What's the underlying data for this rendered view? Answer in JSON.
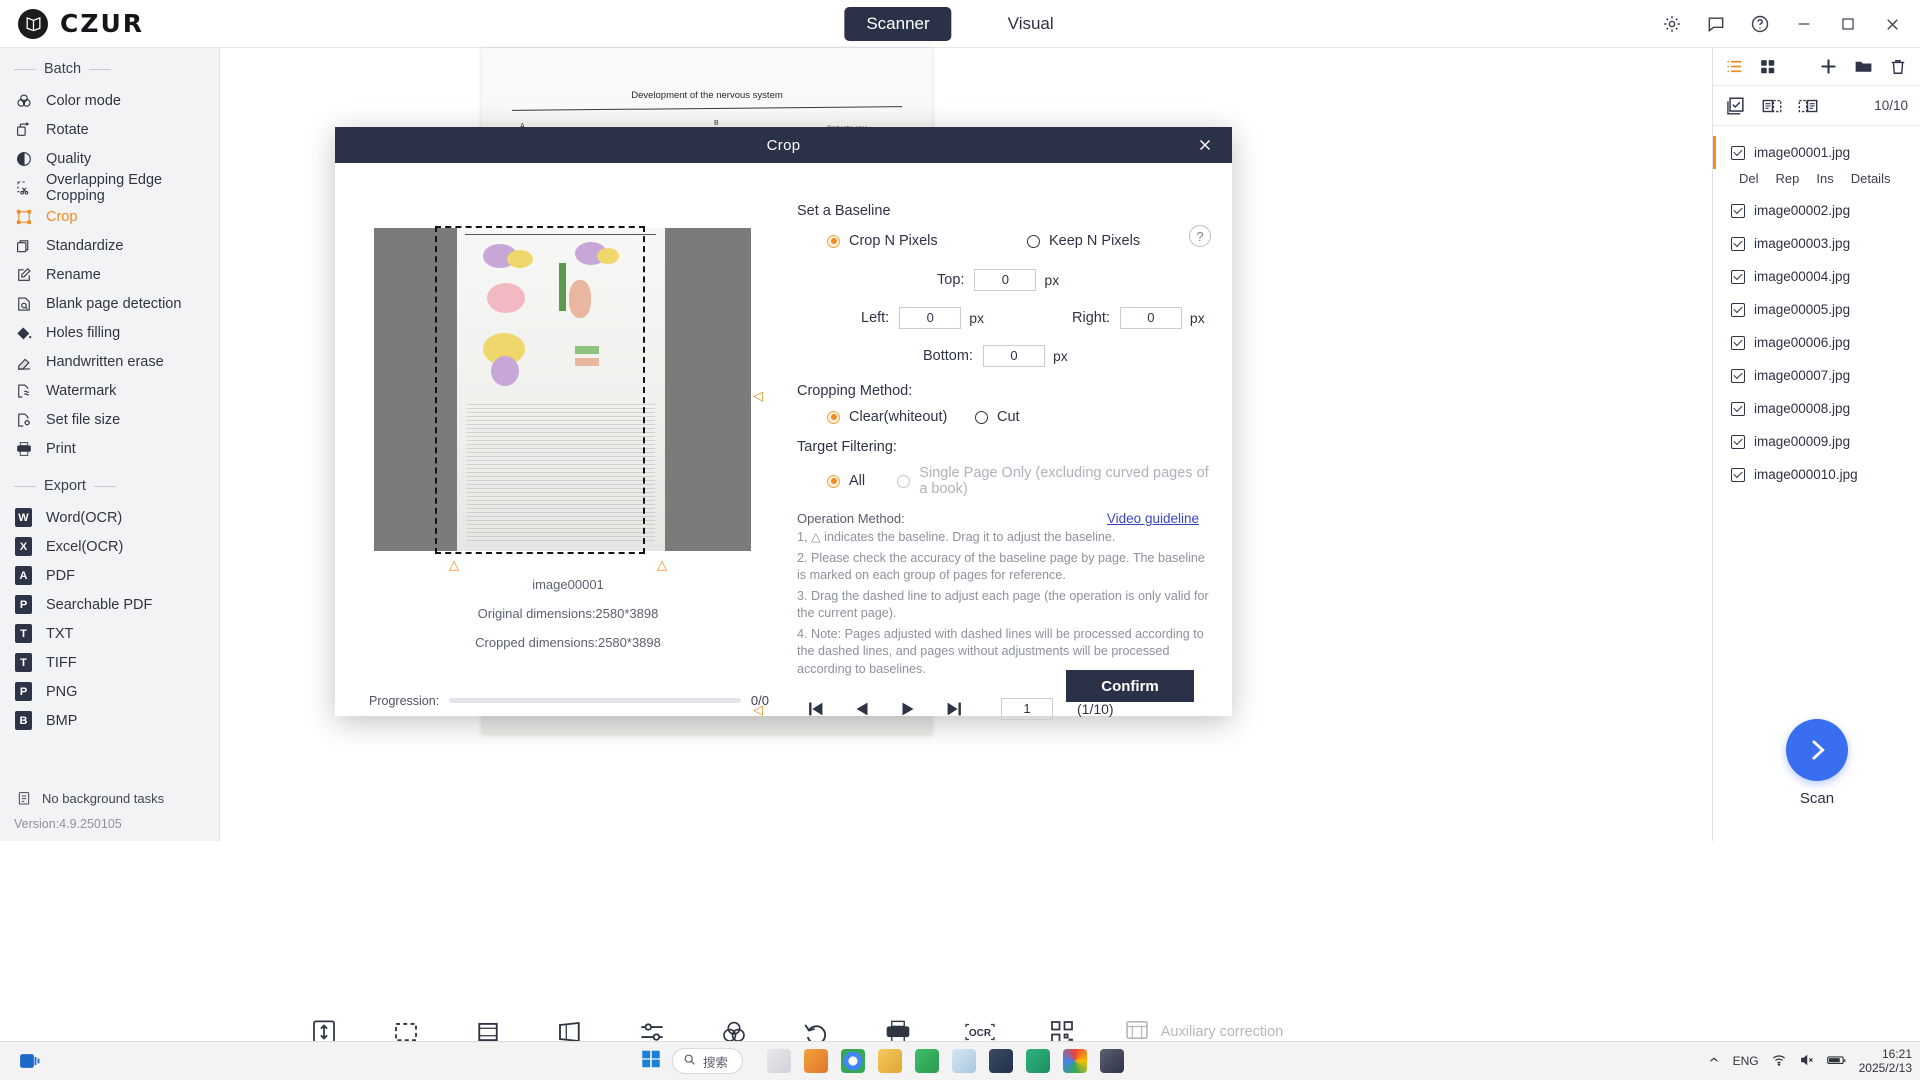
{
  "app": {
    "brand": "CZUR",
    "logo_icon": "book-logo-icon"
  },
  "topnav": {
    "tabs": [
      {
        "label": "Scanner",
        "active": true
      },
      {
        "label": "Visual",
        "active": false
      }
    ]
  },
  "window_controls": {
    "settings_icon": "gear-icon",
    "feedback_icon": "message-icon",
    "help_icon": "question-circle-icon",
    "minimize_icon": "minimize-icon",
    "maximize_icon": "maximize-icon",
    "close_icon": "close-icon"
  },
  "sidebar": {
    "group_batch": "Batch",
    "group_export": "Export",
    "batch_items": [
      {
        "label": "Color mode",
        "icon": "color-circles-icon",
        "active": false
      },
      {
        "label": "Rotate",
        "icon": "rotate-pages-icon",
        "active": false
      },
      {
        "label": "Quality",
        "icon": "contrast-icon",
        "active": false
      },
      {
        "label": "Overlapping Edge Cropping",
        "icon": "scissors-crop-icon",
        "active": false
      },
      {
        "label": "Crop",
        "icon": "crop-handles-icon",
        "active": true
      },
      {
        "label": "Standardize",
        "icon": "stack-pages-icon",
        "active": false
      },
      {
        "label": "Rename",
        "icon": "pencil-square-icon",
        "active": false
      },
      {
        "label": "Blank page detection",
        "icon": "page-search-icon",
        "active": false
      },
      {
        "label": "Holes filling",
        "icon": "paint-bucket-icon",
        "active": false
      },
      {
        "label": "Handwritten erase",
        "icon": "eraser-icon",
        "active": false
      },
      {
        "label": "Watermark",
        "icon": "watermark-page-icon",
        "active": false
      },
      {
        "label": "Set file size",
        "icon": "file-size-icon",
        "active": false
      },
      {
        "label": "Print",
        "icon": "printer-icon",
        "active": false
      }
    ],
    "export_items": [
      {
        "label": "Word(OCR)",
        "badge": "W"
      },
      {
        "label": "Excel(OCR)",
        "badge": "X"
      },
      {
        "label": "PDF",
        "badge": "A"
      },
      {
        "label": "Searchable PDF",
        "badge": "P"
      },
      {
        "label": "TXT",
        "badge": "T"
      },
      {
        "label": "TIFF",
        "badge": "T"
      },
      {
        "label": "PNG",
        "badge": "P"
      },
      {
        "label": "BMP",
        "badge": "B"
      }
    ],
    "footer": {
      "task_status": "No background tasks",
      "task_icon": "clipboard-icon",
      "version": "Version:4.9.250105"
    }
  },
  "canvas": {
    "document_title": "Development of the nervous system",
    "labels": [
      "A",
      "B"
    ],
    "caption_right": "Orchestra spec"
  },
  "toolbar": {
    "buttons": [
      {
        "icon": "fit-height-icon",
        "name": "fit-height-button"
      },
      {
        "icon": "marquee-select-icon",
        "name": "marquee-select-button"
      },
      {
        "icon": "crop-frame-icon",
        "name": "crop-button"
      },
      {
        "icon": "perspective-correct-icon",
        "name": "perspective-button"
      },
      {
        "icon": "sliders-icon",
        "name": "adjust-button"
      },
      {
        "icon": "color-circles-icon",
        "name": "color-button"
      },
      {
        "icon": "undo-icon",
        "name": "undo-button"
      },
      {
        "icon": "printer-icon",
        "name": "print-button"
      },
      {
        "icon": "ocr-icon",
        "name": "ocr-button"
      },
      {
        "icon": "qr-code-icon",
        "name": "qrcode-button"
      }
    ],
    "auxiliary_label": "Auxiliary correction",
    "auxiliary_icon": "auxiliary-correction-icon"
  },
  "right_panel": {
    "view_list_icon": "list-view-icon",
    "view_grid_icon": "grid-view-icon",
    "add_icon": "plus-icon",
    "folder_icon": "folder-icon",
    "delete_icon": "trash-icon",
    "select_all_icon": "select-all-icon",
    "select_odd_icon": "select-odd-icon",
    "select_even_icon": "select-even-icon",
    "count": "10/10",
    "selected_actions": [
      "Del",
      "Rep",
      "Ins",
      "Details"
    ],
    "files": [
      {
        "name": "image00001.jpg",
        "checked": true,
        "selected": true
      },
      {
        "name": "image00002.jpg",
        "checked": true,
        "selected": false
      },
      {
        "name": "image00003.jpg",
        "checked": true,
        "selected": false
      },
      {
        "name": "image00004.jpg",
        "checked": true,
        "selected": false
      },
      {
        "name": "image00005.jpg",
        "checked": true,
        "selected": false
      },
      {
        "name": "image00006.jpg",
        "checked": true,
        "selected": false
      },
      {
        "name": "image00007.jpg",
        "checked": true,
        "selected": false
      },
      {
        "name": "image00008.jpg",
        "checked": true,
        "selected": false
      },
      {
        "name": "image00009.jpg",
        "checked": true,
        "selected": false
      },
      {
        "name": "image000010.jpg",
        "checked": true,
        "selected": false
      }
    ],
    "scan_label": "Scan",
    "scan_icon": "chevron-right-icon"
  },
  "dialog": {
    "title": "Crop",
    "close_icon": "close-icon",
    "help_icon": "question-icon",
    "baseline_section": "Set a Baseline",
    "baseline_options": [
      {
        "label": "Crop N Pixels",
        "selected": true
      },
      {
        "label": "Keep N Pixels",
        "selected": false
      }
    ],
    "fields": {
      "top_label": "Top:",
      "top_value": "0",
      "left_label": "Left:",
      "left_value": "0",
      "right_label": "Right:",
      "right_value": "0",
      "bottom_label": "Bottom:",
      "bottom_value": "0",
      "unit": "px"
    },
    "cropping_method_label": "Cropping Method:",
    "cropping_methods": [
      {
        "label": "Clear(whiteout)",
        "selected": true
      },
      {
        "label": "Cut",
        "selected": false
      }
    ],
    "target_filtering_label": "Target Filtering:",
    "target_filtering": [
      {
        "label": "All",
        "selected": true,
        "disabled": false
      },
      {
        "label": "Single Page Only (excluding curved pages of a book)",
        "selected": false,
        "disabled": true
      }
    ],
    "operation_method_label": "Operation Method:",
    "video_guideline": "Video guideline",
    "instructions": [
      "1, △ indicates the baseline. Drag it to adjust the baseline.",
      "2. Please check the accuracy of the baseline page by page. The baseline is marked on each group of pages for reference.",
      "3. Drag the dashed line to adjust each page (the operation is only valid for the current page).",
      "4. Note: Pages adjusted with dashed lines will be processed according to the dashed lines, and pages without adjustments will be processed according to baselines."
    ],
    "preview": {
      "image_name": "image00001",
      "original_dimensions": "Original dimensions:2580*3898",
      "cropped_dimensions": "Cropped dimensions:2580*3898",
      "progression_label": "Progression:",
      "progression_value": "0/0"
    },
    "nav": {
      "first_icon": "skip-first-icon",
      "prev_icon": "prev-icon",
      "play_icon": "play-icon",
      "last_icon": "skip-last-icon",
      "page_value": "1",
      "page_total": "(1/10)"
    },
    "confirm_label": "Confirm"
  },
  "taskbar": {
    "start_icon": "windows-start-icon",
    "taskview_icon": "task-view-icon",
    "search_placeholder": "搜索",
    "search_icon": "search-icon",
    "apps": [
      "snip-icon",
      "store-icon",
      "chrome-icon",
      "explorer-icon",
      "chat-icon",
      "chart-icon",
      "terminal-icon",
      "n-app-icon",
      "color-app-icon",
      "czur-app-icon"
    ],
    "tray": {
      "chevron_icon": "chevron-up-icon",
      "language": "ENG",
      "wifi_icon": "wifi-icon",
      "volume_icon": "volume-mute-icon",
      "battery_icon": "battery-icon"
    },
    "clock_time": "16:21",
    "clock_date": "2025/2/13"
  }
}
